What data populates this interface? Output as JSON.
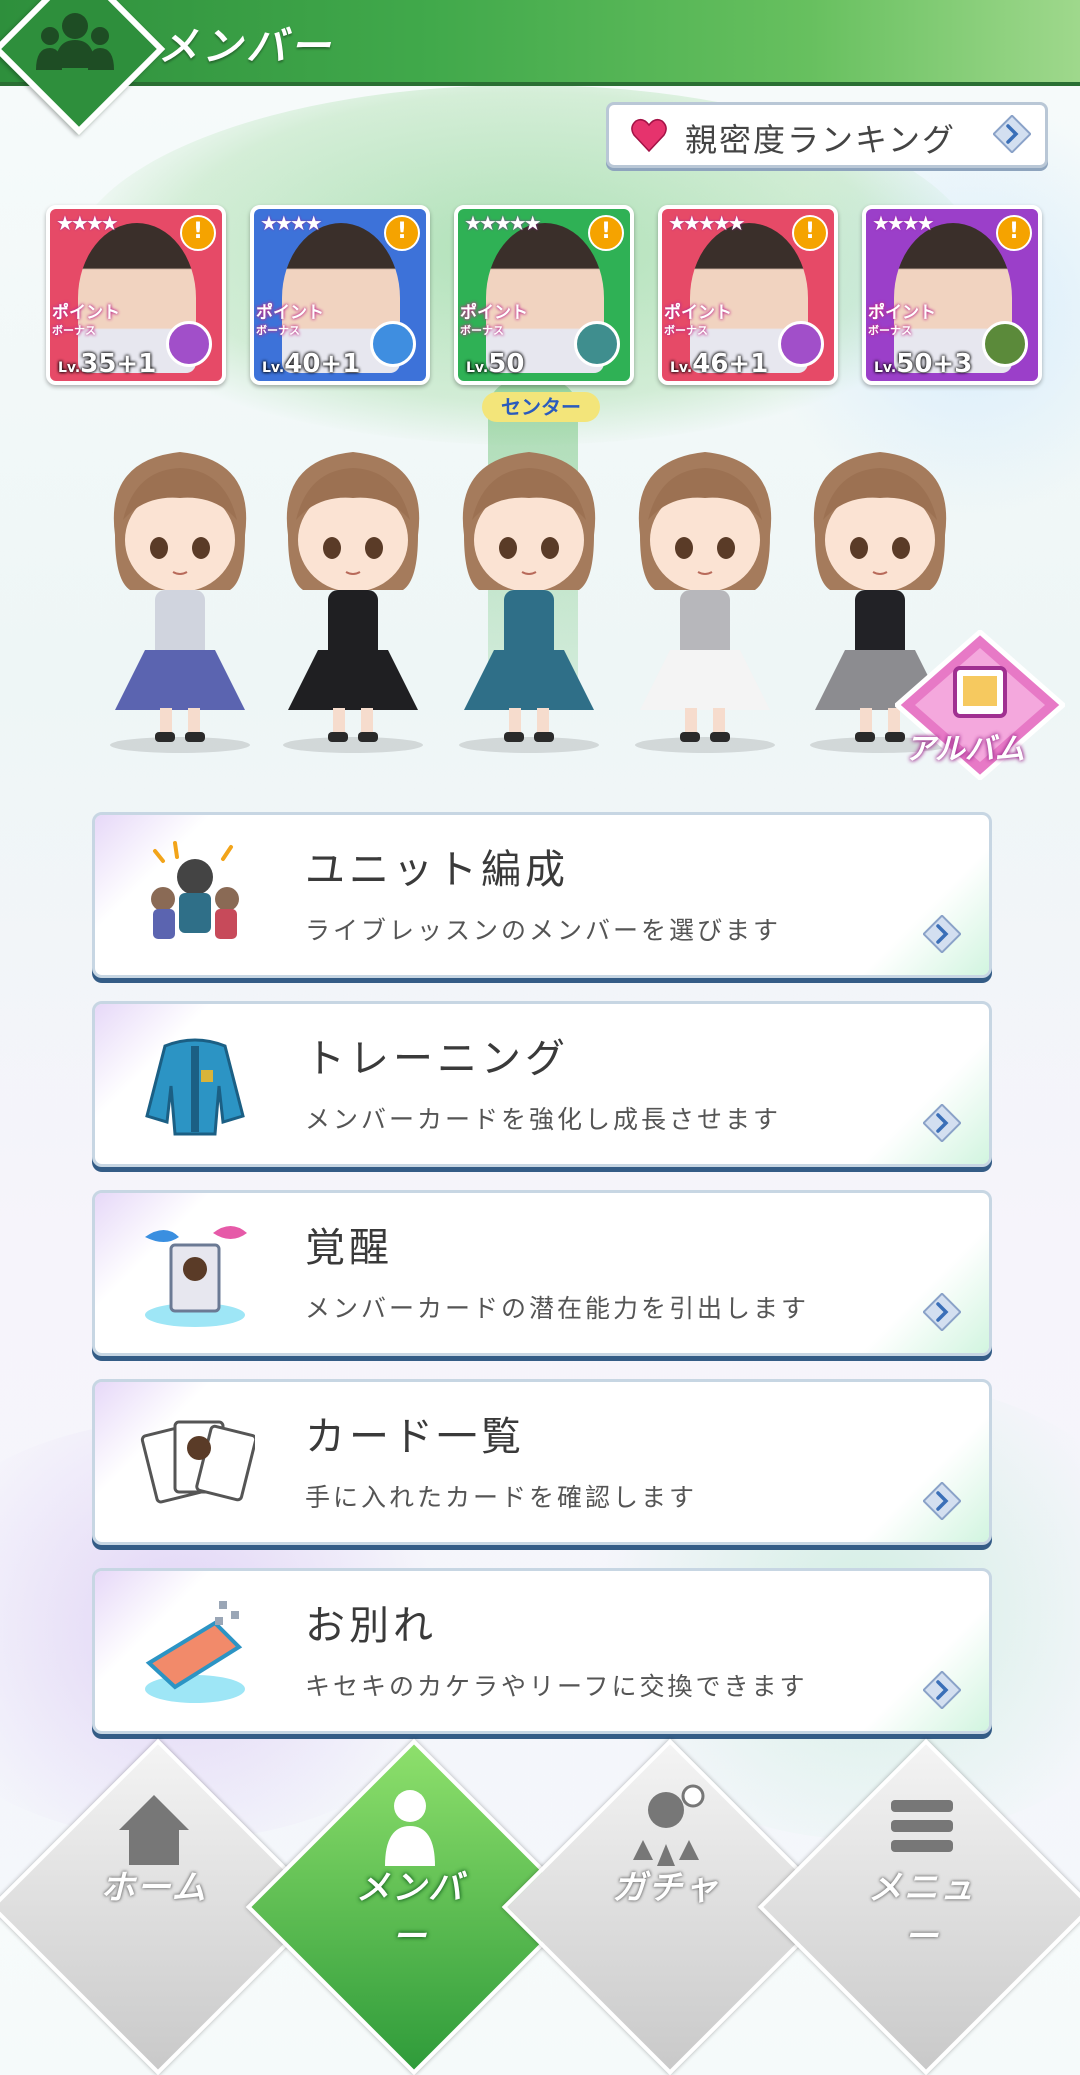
{
  "header": {
    "title": "メンバー",
    "icon": "members-icon"
  },
  "ranking": {
    "label": "親密度ランキング",
    "icon": "heart-icon"
  },
  "cards": [
    {
      "stars": "★★★★",
      "level": "35+1",
      "lv_prefix": "Lv.",
      "point_label": "ポイント",
      "bonus_label": "ボーナス",
      "frame_color": "#e64a67",
      "type_color": "#a14fc9"
    },
    {
      "stars": "★★★★",
      "level": "40+1",
      "lv_prefix": "Lv.",
      "point_label": "ポイント",
      "bonus_label": "ボーナス",
      "frame_color": "#3d72d9",
      "type_color": "#3f8ee0"
    },
    {
      "stars": "★★★★★",
      "level": "50",
      "lv_prefix": "Lv.",
      "point_label": "ポイント",
      "bonus_label": "ボーナス",
      "frame_color": "#2fb155",
      "type_color": "#3f8e8e"
    },
    {
      "stars": "★★★★★",
      "level": "46+1",
      "lv_prefix": "Lv.",
      "point_label": "ポイント",
      "bonus_label": "ボーナス",
      "frame_color": "#e64a67",
      "type_color": "#a14fc9"
    },
    {
      "stars": "★★★★",
      "level": "50+3",
      "lv_prefix": "Lv.",
      "point_label": "ポイント",
      "bonus_label": "ボーナス",
      "frame_color": "#9b3fc9",
      "type_color": "#5b8a3a"
    }
  ],
  "center_label": "センター",
  "chibis": [
    {
      "outfit": "#5b64b0",
      "top": "#d0d4de"
    },
    {
      "outfit": "#1f1f22",
      "top": "#1f1f22"
    },
    {
      "outfit": "#2f6f88",
      "top": "#2f6f88"
    },
    {
      "outfit": "#f4f4f4",
      "top": "#b7b7bb"
    },
    {
      "outfit": "#8c8c90",
      "top": "#222226"
    }
  ],
  "album": {
    "label": "アルバム"
  },
  "menu": [
    {
      "title": "ユニット編成",
      "desc": "ライブレッスンのメンバーを選びます",
      "icon": "unit-group-icon"
    },
    {
      "title": "トレーニング",
      "desc": "メンバーカードを強化し成長させます",
      "icon": "jacket-icon"
    },
    {
      "title": "覚醒",
      "desc": "メンバーカードの潜在能力を引出します",
      "icon": "awaken-candy-icon"
    },
    {
      "title": "カード一覧",
      "desc": "手に入れたカードを確認します",
      "icon": "card-stack-icon"
    },
    {
      "title": "お別れ",
      "desc": "キセキのカケラやリーフに交換できます",
      "icon": "farewell-exchange-icon"
    }
  ],
  "nav": [
    {
      "label": "ホーム",
      "icon": "home-icon",
      "active": false
    },
    {
      "label": "メンバー",
      "icon": "members-icon",
      "active": true
    },
    {
      "label": "ガチャ",
      "icon": "gacha-icon",
      "active": false
    },
    {
      "label": "メニュー",
      "icon": "menu-icon",
      "active": false
    }
  ]
}
